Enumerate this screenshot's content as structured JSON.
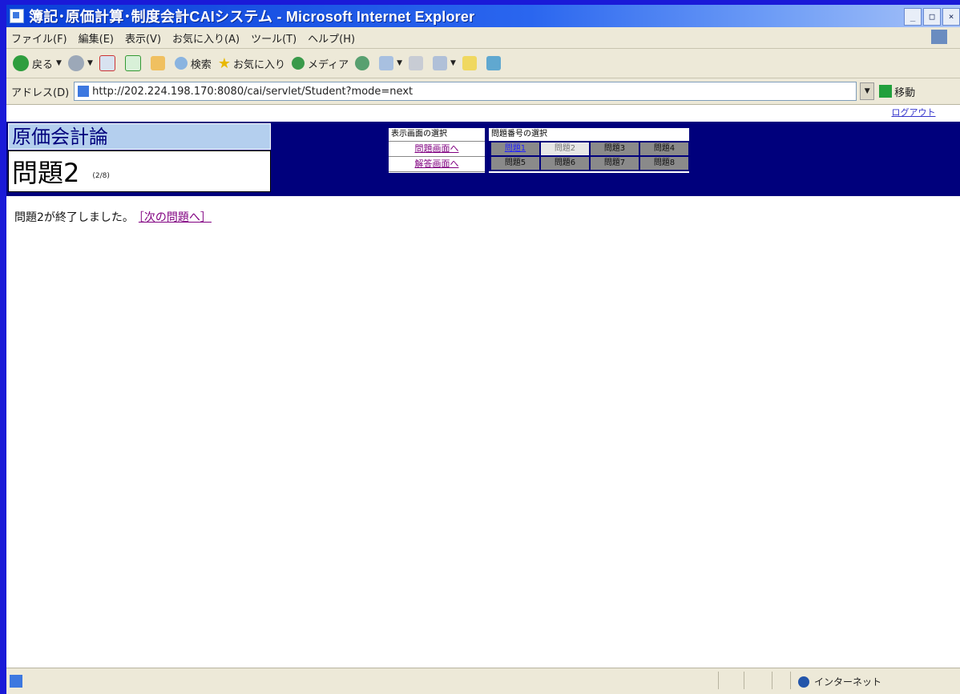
{
  "window": {
    "title": "簿記･原価計算･制度会計CAIシステム - Microsoft Internet Explorer",
    "controls": [
      "_",
      "□",
      "×"
    ]
  },
  "menu": [
    "ファイル(F)",
    "編集(E)",
    "表示(V)",
    "お気に入り(A)",
    "ツール(T)",
    "ヘルプ(H)"
  ],
  "toolbar": {
    "back_label": "戻る",
    "search_label": "検索",
    "favorites_label": "お気に入り",
    "media_label": "メディア"
  },
  "address": {
    "label": "アドレス(D)",
    "url": "http://202.224.198.170:8080/cai/servlet/Student?mode=next",
    "go_label": "移動"
  },
  "page": {
    "subject": "原価会計論",
    "question_title": "問題2",
    "question_count": "(2/8)",
    "display_select": {
      "header": "表示画面の選択",
      "links": [
        "問題画面へ",
        "解答画面へ"
      ]
    },
    "problem_select": {
      "header": "問題番号の選択",
      "items": [
        "問題1",
        "問題2",
        "問題3",
        "問題4",
        "問題5",
        "問題6",
        "問題7",
        "問題8"
      ],
      "current": "問題2"
    },
    "logout_label": "ログアウト",
    "message": "問題2が終了しました。",
    "next_link": "［次の問題へ］"
  },
  "status": {
    "zone": "インターネット"
  },
  "colors": {
    "header_navy": "#00007c",
    "subject_bg": "#b4cfee",
    "visited_link": "#800080",
    "background": "#1a1ad8"
  }
}
